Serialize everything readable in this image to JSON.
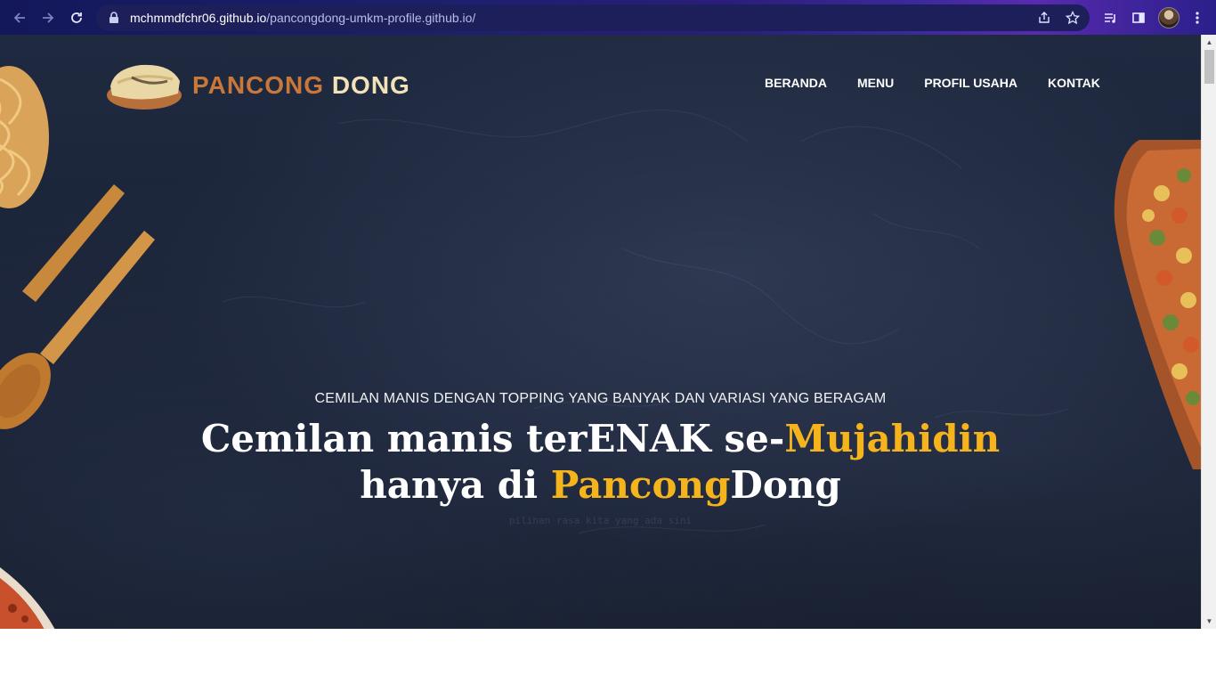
{
  "browser": {
    "url_host": "mchmmdfchr06.github.io",
    "url_path": "/pancongdong-umkm-profile.github.io/"
  },
  "site": {
    "logo": {
      "word1": "PANCONG",
      "word2": "DONG"
    },
    "nav": [
      {
        "label": "BERANDA"
      },
      {
        "label": "MENU"
      },
      {
        "label": "PROFIL USAHA"
      },
      {
        "label": "KONTAK"
      }
    ]
  },
  "hero": {
    "tagline": "CEMILAN MANIS DENGAN TOPPING YANG BANYAK DAN VARIASI YANG BERAGAM",
    "headline": {
      "line1_a": "Cemilan manis terENAK se-",
      "line1_b": "Mujahidin",
      "line2_a": "hanya di ",
      "line2_b": "Pancong",
      "line2_c": "Dong"
    },
    "faint_text": "pilihan rasa kita yang ada sini"
  },
  "colors": {
    "accent": "#f5b41c",
    "logo_primary": "#c9773a",
    "logo_secondary": "#f2e2b8"
  }
}
